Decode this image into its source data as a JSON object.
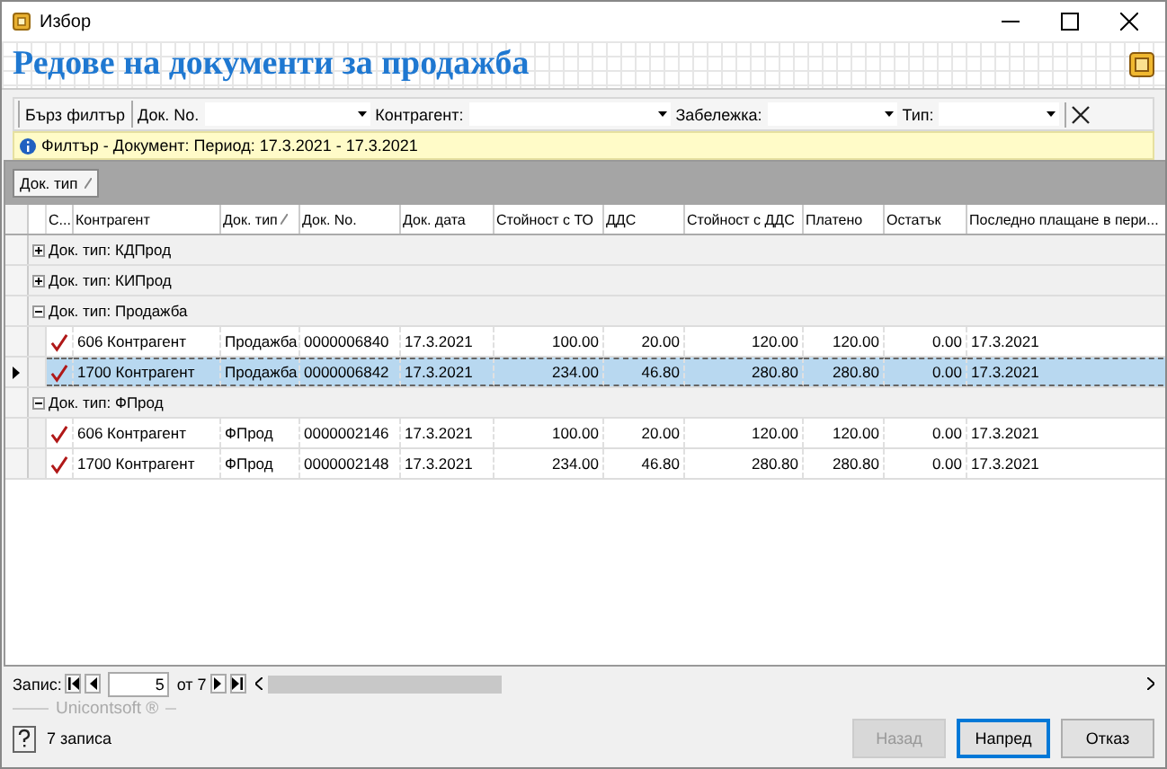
{
  "window": {
    "title": "Избор"
  },
  "header": {
    "title": "Редове на документи за продажба"
  },
  "filter_bar": {
    "quick_filter": "Бърз филтър",
    "fields": [
      {
        "label": "Док. No."
      },
      {
        "label": "Контрагент:"
      },
      {
        "label": "Забележка:"
      },
      {
        "label": "Тип:"
      }
    ]
  },
  "info_bar": {
    "text": "Филтър - Документ: Период: 17.3.2021 - 17.3.2021"
  },
  "group_panel": {
    "columns": [
      {
        "label": "Док. тип"
      }
    ]
  },
  "table": {
    "columns": [
      {
        "label": "С..."
      },
      {
        "label": "Контрагент"
      },
      {
        "label": "Док. тип",
        "sorted": true
      },
      {
        "label": "Док. No."
      },
      {
        "label": "Док. дата"
      },
      {
        "label": "Стойност с ТО"
      },
      {
        "label": "ДДС"
      },
      {
        "label": "Стойност с ДДС"
      },
      {
        "label": "Платено"
      },
      {
        "label": "Остатък"
      },
      {
        "label": "Последно плащане в пери..."
      }
    ],
    "groups": [
      {
        "label": "Док. тип: КДПрод",
        "expanded": false
      },
      {
        "label": "Док. тип: КИПрод",
        "expanded": false
      },
      {
        "label": "Док. тип: Продажба",
        "expanded": true,
        "rows": [
          {
            "checked": true,
            "selected": false,
            "cells": [
              "606 Контрагент",
              "Продажба",
              "0000006840",
              "17.3.2021",
              "100.00",
              "20.00",
              "120.00",
              "120.00",
              "0.00",
              "17.3.2021"
            ]
          },
          {
            "checked": true,
            "selected": true,
            "cells": [
              "1700 Контрагент",
              "Продажба",
              "0000006842",
              "17.3.2021",
              "234.00",
              "46.80",
              "280.80",
              "280.80",
              "0.00",
              "17.3.2021"
            ]
          }
        ]
      },
      {
        "label": "Док. тип: ФПрод",
        "expanded": true,
        "rows": [
          {
            "checked": true,
            "selected": false,
            "cells": [
              "606 Контрагент",
              "ФПрод",
              "0000002146",
              "17.3.2021",
              "100.00",
              "20.00",
              "120.00",
              "120.00",
              "0.00",
              "17.3.2021"
            ]
          },
          {
            "checked": true,
            "selected": false,
            "cells": [
              "1700 Контрагент",
              "ФПрод",
              "0000002148",
              "17.3.2021",
              "234.00",
              "46.80",
              "280.80",
              "280.80",
              "0.00",
              "17.3.2021"
            ]
          }
        ]
      }
    ]
  },
  "navigator": {
    "label": "Запис:",
    "value": "5",
    "total": "от 7"
  },
  "footer": {
    "brand": "Unicontsoft ®",
    "status": "7 записа",
    "buttons": [
      {
        "label": "Назад",
        "disabled": true,
        "default": false
      },
      {
        "label": "Напред",
        "disabled": false,
        "default": true
      },
      {
        "label": "Отказ",
        "disabled": false,
        "default": false
      }
    ]
  }
}
